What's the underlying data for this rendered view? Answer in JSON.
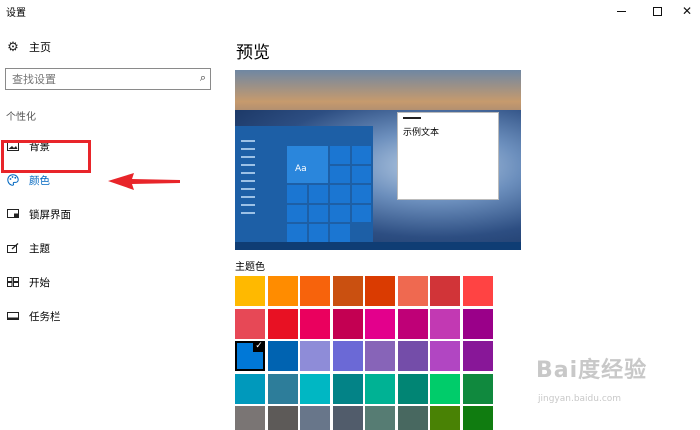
{
  "window": {
    "title": "设置",
    "minimize_label": "",
    "maximize_label": "",
    "close_label": "✕"
  },
  "sidebar": {
    "home": {
      "label": "主页",
      "icon": "gear-icon"
    },
    "search": {
      "placeholder": "查找设置",
      "value": ""
    },
    "section_label": "个性化",
    "items": [
      {
        "label": "背景",
        "icon": "image-icon"
      },
      {
        "label": "颜色",
        "icon": "palette-icon",
        "active": true
      },
      {
        "label": "锁屏界面",
        "icon": "lock-screen-icon"
      },
      {
        "label": "主题",
        "icon": "theme-icon"
      },
      {
        "label": "开始",
        "icon": "start-icon"
      },
      {
        "label": "任务栏",
        "icon": "taskbar-icon"
      }
    ]
  },
  "main": {
    "title": "预览",
    "preview": {
      "tile_text": "Aa",
      "window_text": "示例文本"
    },
    "theme_colors_label": "主题色",
    "colors": [
      "#FFB900",
      "#FF8C00",
      "#F7630C",
      "#CA5010",
      "#DA3B01",
      "#EF6950",
      "#D13438",
      "#FF4343",
      "#E74856",
      "#E81123",
      "#EA005E",
      "#C30052",
      "#E3008C",
      "#BF0077",
      "#C239B3",
      "#9A0089",
      "#0078D7",
      "#0063B1",
      "#8E8CD8",
      "#6B69D6",
      "#8764B8",
      "#744DA9",
      "#B146C2",
      "#881798",
      "#0099BC",
      "#2D7D9A",
      "#00B7C3",
      "#038387",
      "#00B294",
      "#018574",
      "#00CC6A",
      "#10893E",
      "#7A7574",
      "#5D5A58",
      "#68768A",
      "#515C6B",
      "#567C73",
      "#486860",
      "#498205",
      "#107C10"
    ],
    "selected_color": "#0078D7"
  },
  "watermark": {
    "main": "Bai度经验",
    "sub": "jingyan.baidu.com"
  },
  "accent": {
    "highlight": "#e8252a",
    "link": "#0067c0"
  }
}
